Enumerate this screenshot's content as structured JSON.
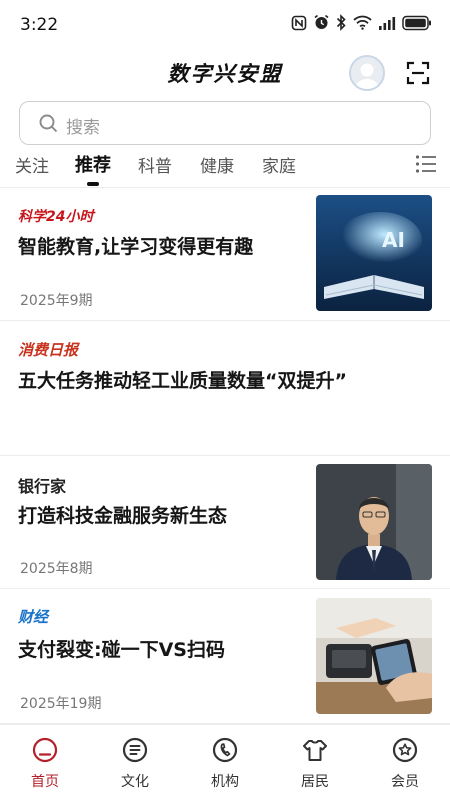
{
  "status_bar": {
    "time": "3:22",
    "icons": [
      "nfc-icon",
      "alarm-icon",
      "bluetooth-icon",
      "wifi-icon",
      "signal-icon",
      "battery-icon"
    ]
  },
  "header": {
    "title": "数字兴安盟",
    "avatar_icon": "avatar-icon",
    "scan_icon": "scan-icon"
  },
  "search": {
    "placeholder": "搜索"
  },
  "tabs": {
    "items": [
      {
        "label": "关注",
        "active": false
      },
      {
        "label": "推荐",
        "active": true
      },
      {
        "label": "科普",
        "active": false
      },
      {
        "label": "健康",
        "active": false
      },
      {
        "label": "家庭",
        "active": false
      }
    ],
    "menu_icon": "list-menu-icon"
  },
  "feed": [
    {
      "source": "科学24小时",
      "headline": "智能教育,让学习变得更有趣",
      "issue": "2025年9期",
      "source_color": "#c8161d"
    },
    {
      "source": "消费日报",
      "headline": "五大任务推动轻工业质量数量“双提升”",
      "source_color": "#c8341d"
    },
    {
      "source": "银行家",
      "headline": "打造科技金融服务新生态",
      "issue": "2025年8期",
      "source_color": "#222222"
    },
    {
      "source": "财经",
      "headline": "支付裂变:碰一下VS扫码",
      "issue": "2025年19期",
      "source_color": "#1a73c9"
    }
  ],
  "bottom_nav": {
    "items": [
      {
        "label": "首页",
        "icon": "home-icon",
        "active": true
      },
      {
        "label": "文化",
        "icon": "culture-icon",
        "active": false
      },
      {
        "label": "机构",
        "icon": "institution-icon",
        "active": false
      },
      {
        "label": "居民",
        "icon": "resident-icon",
        "active": false
      },
      {
        "label": "会员",
        "icon": "member-icon",
        "active": false
      }
    ]
  },
  "colors": {
    "accent": "#b2212a",
    "text": "#161616",
    "muted": "#777777",
    "divider": "#ededed"
  }
}
